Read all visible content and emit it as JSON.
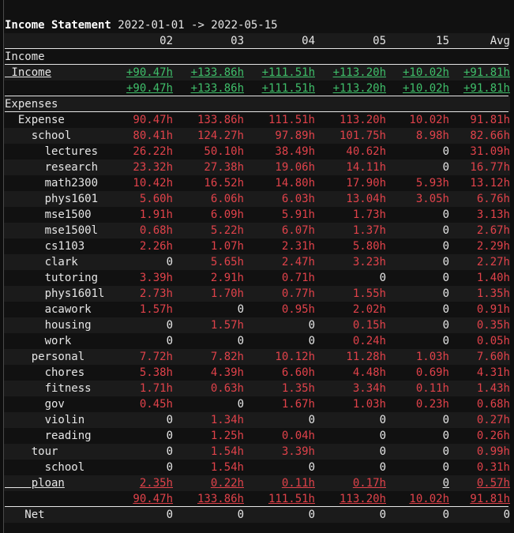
{
  "title": {
    "bold": "Income Statement",
    "range": "2022-01-01 -> 2022-05-15"
  },
  "columns": [
    "02",
    "03",
    "04",
    "05",
    "15",
    "Avg"
  ],
  "income_header": "Income",
  "income_row": {
    "label": " Income",
    "values": [
      "+90.47h",
      "+133.86h",
      "+111.51h",
      "+113.20h",
      "+10.02h",
      "+91.81h"
    ]
  },
  "income_total": [
    "+90.47h",
    "+133.86h",
    "+111.51h",
    "+113.20h",
    "+10.02h",
    "+91.81h"
  ],
  "expenses_header": "Expenses",
  "expense_rows": [
    {
      "label": "  Expense",
      "values": [
        "90.47h",
        "133.86h",
        "111.51h",
        "113.20h",
        "10.02h",
        "91.81h"
      ]
    },
    {
      "label": "    school",
      "values": [
        "80.41h",
        "124.27h",
        "97.89h",
        "101.75h",
        "8.98h",
        "82.66h"
      ]
    },
    {
      "label": "      lectures",
      "values": [
        "26.22h",
        "50.10h",
        "38.49h",
        "40.62h",
        "0",
        "31.09h"
      ]
    },
    {
      "label": "      research",
      "values": [
        "23.32h",
        "27.38h",
        "19.06h",
        "14.11h",
        "0",
        "16.77h"
      ]
    },
    {
      "label": "      math2300",
      "values": [
        "10.42h",
        "16.52h",
        "14.80h",
        "17.90h",
        "5.93h",
        "13.12h"
      ]
    },
    {
      "label": "      phys1601",
      "values": [
        "5.60h",
        "6.06h",
        "6.03h",
        "13.04h",
        "3.05h",
        "6.76h"
      ]
    },
    {
      "label": "      mse1500",
      "values": [
        "1.91h",
        "6.09h",
        "5.91h",
        "1.73h",
        "0",
        "3.13h"
      ]
    },
    {
      "label": "      mse1500l",
      "values": [
        "0.68h",
        "5.22h",
        "6.07h",
        "1.37h",
        "0",
        "2.67h"
      ]
    },
    {
      "label": "      cs1103",
      "values": [
        "2.26h",
        "1.07h",
        "2.31h",
        "5.80h",
        "0",
        "2.29h"
      ]
    },
    {
      "label": "      clark",
      "values": [
        "0",
        "5.65h",
        "2.47h",
        "3.23h",
        "0",
        "2.27h"
      ]
    },
    {
      "label": "      tutoring",
      "values": [
        "3.39h",
        "2.91h",
        "0.71h",
        "0",
        "0",
        "1.40h"
      ]
    },
    {
      "label": "      phys1601l",
      "values": [
        "2.73h",
        "1.70h",
        "0.77h",
        "1.55h",
        "0",
        "1.35h"
      ]
    },
    {
      "label": "      acawork",
      "values": [
        "1.57h",
        "0",
        "0.95h",
        "2.02h",
        "0",
        "0.91h"
      ]
    },
    {
      "label": "      housing",
      "values": [
        "0",
        "1.57h",
        "0",
        "0.15h",
        "0",
        "0.35h"
      ]
    },
    {
      "label": "      work",
      "values": [
        "0",
        "0",
        "0",
        "0.24h",
        "0",
        "0.05h"
      ]
    },
    {
      "label": "    personal",
      "values": [
        "7.72h",
        "7.82h",
        "10.12h",
        "11.28h",
        "1.03h",
        "7.60h"
      ]
    },
    {
      "label": "      chores",
      "values": [
        "5.38h",
        "4.39h",
        "6.60h",
        "4.48h",
        "0.69h",
        "4.31h"
      ]
    },
    {
      "label": "      fitness",
      "values": [
        "1.71h",
        "0.63h",
        "1.35h",
        "3.34h",
        "0.11h",
        "1.43h"
      ]
    },
    {
      "label": "      gov",
      "values": [
        "0.45h",
        "0",
        "1.67h",
        "1.03h",
        "0.23h",
        "0.68h"
      ]
    },
    {
      "label": "      violin",
      "values": [
        "0",
        "1.34h",
        "0",
        "0",
        "0",
        "0.27h"
      ]
    },
    {
      "label": "      reading",
      "values": [
        "0",
        "1.25h",
        "0.04h",
        "0",
        "0",
        "0.26h"
      ]
    },
    {
      "label": "    tour",
      "values": [
        "0",
        "1.54h",
        "3.39h",
        "0",
        "0",
        "0.99h"
      ]
    },
    {
      "label": "      school",
      "values": [
        "0",
        "1.54h",
        "0",
        "0",
        "0",
        "0.31h"
      ]
    },
    {
      "label": "    ploan",
      "values": [
        "2.35h",
        "0.22h",
        "0.11h",
        "0.17h",
        "0",
        "0.57h"
      ]
    }
  ],
  "expense_total": [
    "90.47h",
    "133.86h",
    "111.51h",
    "113.20h",
    "10.02h",
    "91.81h"
  ],
  "net": {
    "label": "   Net",
    "values": [
      "0",
      "0",
      "0",
      "0",
      "0",
      "0"
    ]
  },
  "colors": {
    "positive": "#3fbf6a",
    "negative": "#e0424a",
    "text": "#e6e6e6",
    "background": "#111111"
  }
}
